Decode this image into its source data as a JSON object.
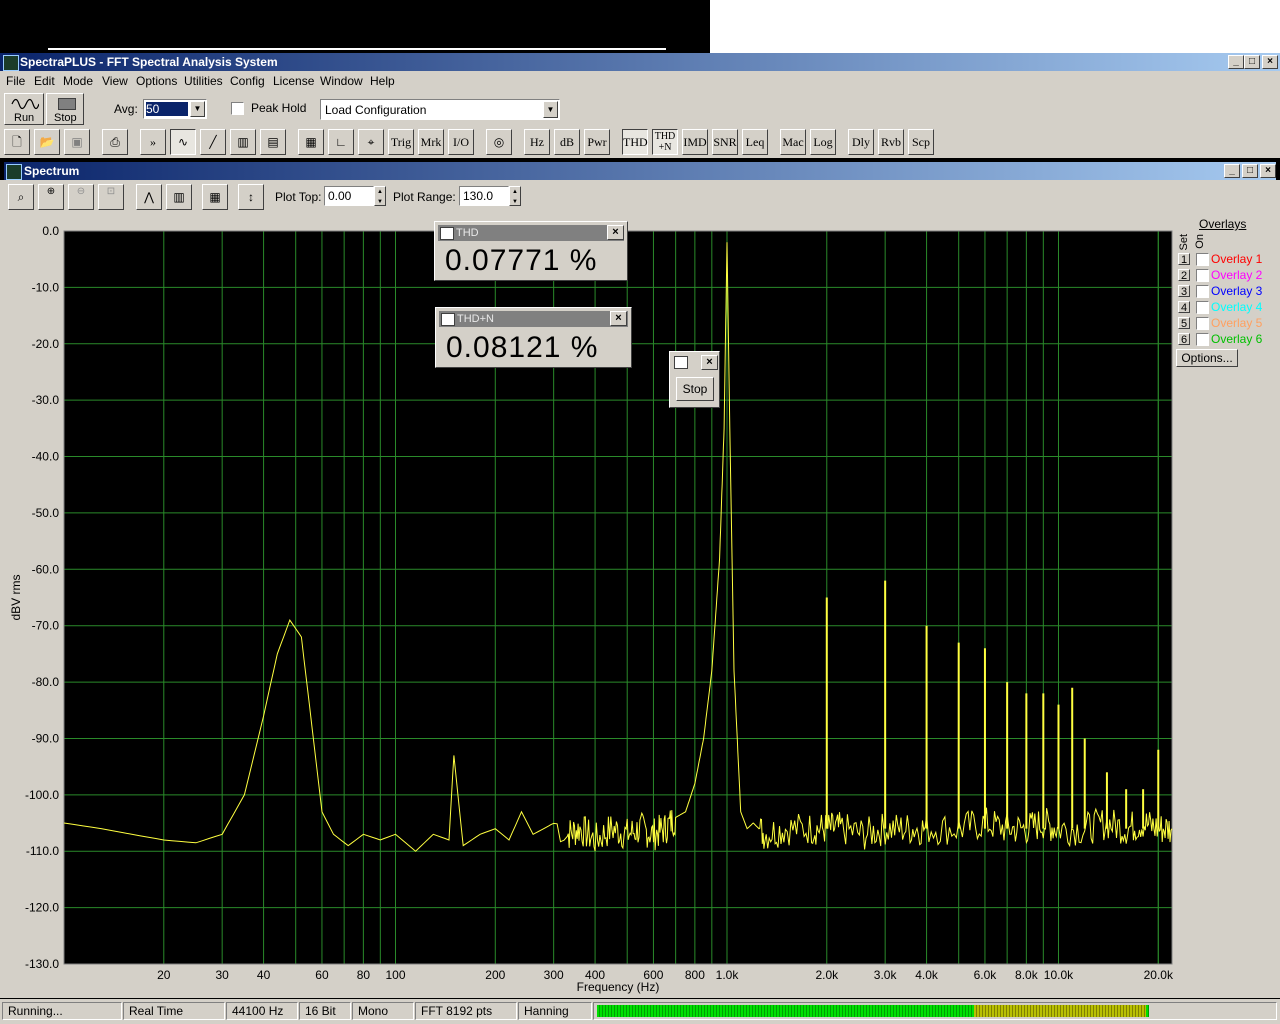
{
  "app": {
    "title": "SpectraPLUS - FFT Spectral Analysis System",
    "menu": [
      "File",
      "Edit",
      "Mode",
      "View",
      "Options",
      "Utilities",
      "Config",
      "License",
      "Window",
      "Help"
    ]
  },
  "toolbar": {
    "run_label": "Run",
    "stop_label": "Stop",
    "avg_label": "Avg:",
    "avg_value": "50",
    "peak_hold_label": "Peak Hold",
    "config_value": "Load Configuration",
    "buttons": [
      "Trig",
      "Mrk",
      "I/O",
      "Hz",
      "dB",
      "Pwr",
      "THD",
      "THD +N",
      "IMD",
      "SNR",
      "Leq",
      "Mac",
      "Log",
      "Dly",
      "Rvb",
      "Scp"
    ]
  },
  "spectrum": {
    "title": "Spectrum",
    "plot_top_label": "Plot Top:",
    "plot_top_value": "0.00",
    "plot_range_label": "Plot Range:",
    "plot_range_value": "130.0"
  },
  "popups": {
    "thd_title": "THD",
    "thd_value": "0.07771 %",
    "thdn_title": "THD+N",
    "thdn_value": "0.08121 %",
    "stop_label": "Stop"
  },
  "overlays": {
    "header": "Overlays",
    "set_label": "Set",
    "on_label": "On",
    "items": [
      {
        "num": "1",
        "name": "Overlay 1",
        "color": "#ff0000"
      },
      {
        "num": "2",
        "name": "Overlay 2",
        "color": "#ff00ff"
      },
      {
        "num": "3",
        "name": "Overlay 3",
        "color": "#0000ff"
      },
      {
        "num": "4",
        "name": "Overlay 4",
        "color": "#00ffff"
      },
      {
        "num": "5",
        "name": "Overlay 5",
        "color": "#ffa060"
      },
      {
        "num": "6",
        "name": "Overlay 6",
        "color": "#00c000"
      }
    ],
    "options_label": "Options..."
  },
  "status": {
    "state": "Running...",
    "mode": "Real Time",
    "rate": "44100 Hz",
    "bits": "16 Bit",
    "channels": "Mono",
    "fft": "FFT 8192 pts",
    "window": "Hanning"
  },
  "chart_data": {
    "type": "line",
    "xlabel": "Frequency (Hz)",
    "ylabel": "dBV rms",
    "xscale": "log",
    "ylim": [
      -130,
      0
    ],
    "yticks": [
      "0.0",
      "-10.0",
      "-20.0",
      "-30.0",
      "-40.0",
      "-50.0",
      "-60.0",
      "-70.0",
      "-80.0",
      "-90.0",
      "-100.0",
      "-110.0",
      "-120.0",
      "-130.0"
    ],
    "xticks": [
      {
        "f": 20,
        "label": "20"
      },
      {
        "f": 30,
        "label": "30"
      },
      {
        "f": 40,
        "label": "40"
      },
      {
        "f": 60,
        "label": "60"
      },
      {
        "f": 80,
        "label": "80"
      },
      {
        "f": 100,
        "label": "100"
      },
      {
        "f": 200,
        "label": "200"
      },
      {
        "f": 300,
        "label": "300"
      },
      {
        "f": 400,
        "label": "400"
      },
      {
        "f": 600,
        "label": "600"
      },
      {
        "f": 800,
        "label": "800"
      },
      {
        "f": 1000,
        "label": "1.0k"
      },
      {
        "f": 2000,
        "label": "2.0k"
      },
      {
        "f": 3000,
        "label": "3.0k"
      },
      {
        "f": 4000,
        "label": "4.0k"
      },
      {
        "f": 6000,
        "label": "6.0k"
      },
      {
        "f": 8000,
        "label": "8.0k"
      },
      {
        "f": 10000,
        "label": "10.0k"
      },
      {
        "f": 20000,
        "label": "20.0k"
      }
    ],
    "xlim": [
      10,
      22000
    ],
    "series": [
      {
        "values_x": [
          10,
          13,
          16,
          20,
          25,
          30,
          35,
          40,
          44,
          48,
          52,
          56,
          60,
          65,
          72,
          80,
          90,
          100,
          115,
          130,
          145,
          150,
          160,
          180,
          200,
          220,
          240,
          260,
          280,
          300,
          330,
          360,
          400,
          450,
          500,
          550,
          600,
          650,
          700,
          750,
          800,
          850,
          900,
          950,
          980,
          1000,
          1020,
          1050,
          1100,
          1150,
          1200,
          1300,
          1500,
          1800,
          2000,
          2200,
          2600,
          3000,
          3500,
          4000,
          5000,
          6000,
          7000,
          8000,
          9000,
          10000,
          12000,
          14000,
          16000,
          18000,
          20000,
          22000
        ],
        "values_y": [
          -105,
          -106,
          -107,
          -108,
          -108.5,
          -107,
          -100,
          -86,
          -75,
          -69,
          -72,
          -88,
          -103,
          -107,
          -109,
          -107,
          -108,
          -107,
          -110,
          -107,
          -108,
          -93,
          -109,
          -107,
          -106,
          -108,
          -103,
          -107,
          -106,
          -105,
          -107,
          -106,
          -108,
          -106,
          -107,
          -106,
          -107,
          -106,
          -104,
          -103,
          -98,
          -90,
          -78,
          -58,
          -35,
          -2,
          -35,
          -78,
          -103,
          -106,
          -105,
          -107,
          -106,
          -106,
          -106,
          -106,
          -107,
          -106,
          -106,
          -106,
          -106,
          -105,
          -106,
          -106,
          -105,
          -106,
          -106,
          -105,
          -106,
          -105,
          -106,
          -106
        ]
      }
    ],
    "harmonics": [
      {
        "f": 2000,
        "db": -65
      },
      {
        "f": 3000,
        "db": -62
      },
      {
        "f": 4000,
        "db": -70
      },
      {
        "f": 5000,
        "db": -73
      },
      {
        "f": 6000,
        "db": -74
      },
      {
        "f": 7000,
        "db": -80
      },
      {
        "f": 8000,
        "db": -82
      },
      {
        "f": 9000,
        "db": -82
      },
      {
        "f": 10000,
        "db": -84
      },
      {
        "f": 11000,
        "db": -81
      },
      {
        "f": 12000,
        "db": -90
      },
      {
        "f": 14000,
        "db": -96
      },
      {
        "f": 16000,
        "db": -99
      },
      {
        "f": 18000,
        "db": -99
      },
      {
        "f": 20000,
        "db": -92
      }
    ]
  }
}
